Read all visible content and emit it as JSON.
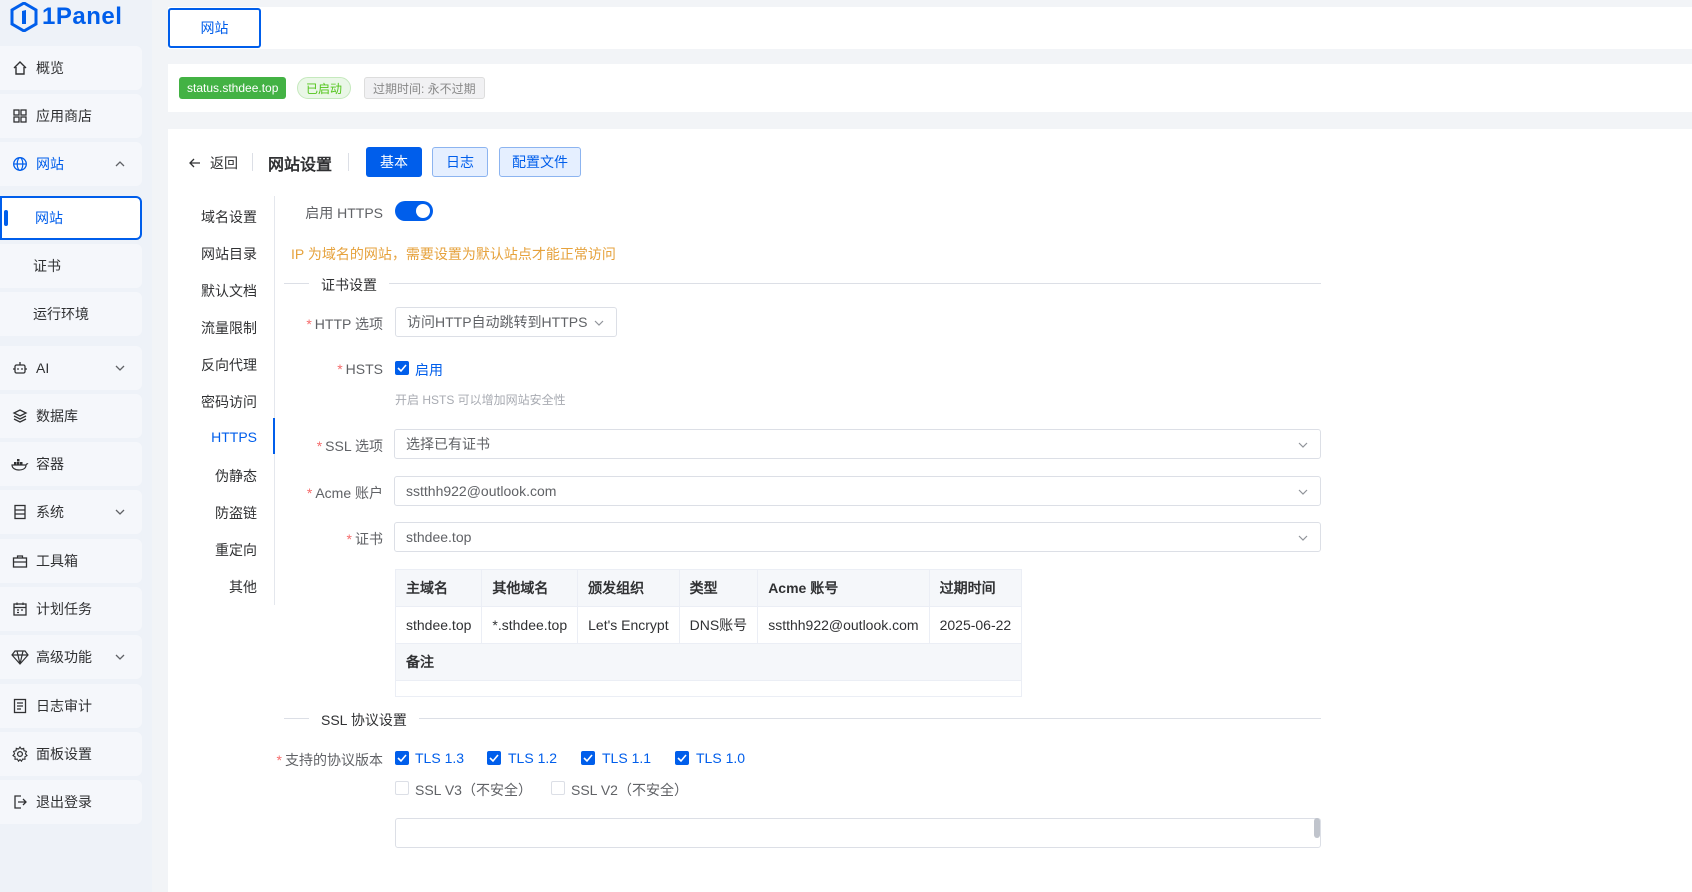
{
  "app": {
    "name": "1Panel"
  },
  "sidebar": {
    "items": [
      {
        "label": "概览",
        "icon": "home-icon"
      },
      {
        "label": "应用商店",
        "icon": "grid-icon"
      },
      {
        "label": "网站",
        "icon": "globe-icon",
        "expanded": true
      },
      {
        "label": "AI",
        "icon": "robot-icon"
      },
      {
        "label": "数据库",
        "icon": "layers-icon"
      },
      {
        "label": "容器",
        "icon": "docker-icon"
      },
      {
        "label": "系统",
        "icon": "server-icon"
      },
      {
        "label": "工具箱",
        "icon": "toolbox-icon"
      },
      {
        "label": "计划任务",
        "icon": "calendar-icon"
      },
      {
        "label": "高级功能",
        "icon": "diamond-icon"
      },
      {
        "label": "日志审计",
        "icon": "log-icon"
      },
      {
        "label": "面板设置",
        "icon": "gear-icon"
      },
      {
        "label": "退出登录",
        "icon": "logout-icon"
      }
    ],
    "website_sub": [
      "网站",
      "证书",
      "运行环境"
    ]
  },
  "tabbar": {
    "active_tab": "网站"
  },
  "status": {
    "domain": "status.sthdee.top",
    "state": "已启动",
    "expire": "过期时间: 永不过期"
  },
  "header": {
    "back": "返回",
    "title": "网站设置",
    "buttons": [
      "基本",
      "日志",
      "配置文件"
    ]
  },
  "subnav": [
    "域名设置",
    "网站目录",
    "默认文档",
    "流量限制",
    "反向代理",
    "密码访问",
    "HTTPS",
    "伪静态",
    "防盗链",
    "重定向",
    "其他"
  ],
  "form": {
    "https_label": "启用 HTTPS",
    "https_enabled": true,
    "warning": "IP 为域名的网站，需要设置为默认站点才能正常访问",
    "cert_section": "证书设置",
    "http_option_label": "HTTP 选项",
    "http_option_value": "访问HTTP自动跳转到HTTPS",
    "hsts_label": "HSTS",
    "hsts_checkbox": "启用",
    "hsts_hint": "开启 HSTS 可以增加网站安全性",
    "ssl_option_label": "SSL 选项",
    "ssl_option_value": "选择已有证书",
    "acme_label": "Acme 账户",
    "acme_value": "sstthh922@outlook.com",
    "cert_label": "证书",
    "cert_value": "sthdee.top",
    "ssl_section": "SSL 协议设置",
    "protocol_label": "支持的协议版本",
    "protocols": [
      {
        "label": "TLS 1.3",
        "checked": true
      },
      {
        "label": "TLS 1.2",
        "checked": true
      },
      {
        "label": "TLS 1.1",
        "checked": true
      },
      {
        "label": "TLS 1.0",
        "checked": true
      },
      {
        "label": "SSL V3（不安全）",
        "checked": false
      },
      {
        "label": "SSL V2（不安全）",
        "checked": false
      }
    ]
  },
  "cert_table": {
    "headers": [
      "主域名",
      "其他域名",
      "颁发组织",
      "类型",
      "Acme 账号",
      "过期时间"
    ],
    "row": [
      "sthdee.top",
      "*.sthdee.top",
      "Let's Encrypt",
      "DNS账号",
      "sstthh922@outlook.com",
      "2025-06-22"
    ],
    "remark_label": "备注"
  },
  "colors": {
    "primary": "#005eeb",
    "success": "#43b244",
    "warning": "#e6a23c",
    "danger": "#f56c6c"
  }
}
